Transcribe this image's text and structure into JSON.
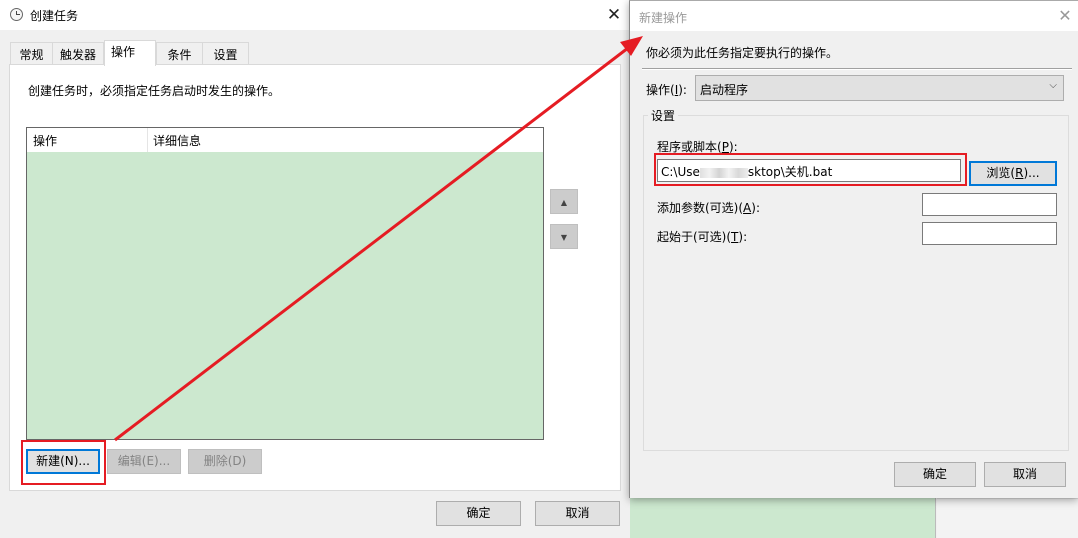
{
  "create_task_dialog": {
    "title": "创建任务",
    "close_glyph": "✕",
    "tabs": [
      {
        "label": "常规",
        "active": false
      },
      {
        "label": "触发器",
        "active": false
      },
      {
        "label": "操作",
        "active": true
      },
      {
        "label": "条件",
        "active": false
      },
      {
        "label": "设置",
        "active": false
      }
    ],
    "description": "创建任务时，必须指定任务启动时发生的操作。",
    "actions_table": {
      "columns": [
        "操作",
        "详细信息"
      ],
      "rows": []
    },
    "move_up_glyph": "▲",
    "move_down_glyph": "▼",
    "buttons": {
      "new": "新建(N)...",
      "edit": "编辑(E)...",
      "delete": "删除(D)",
      "ok": "确定",
      "cancel": "取消"
    }
  },
  "new_action_dialog": {
    "title": "新建操作",
    "close_glyph": "✕",
    "instruction": "你必须为此任务指定要执行的操作。",
    "action_label": "操作(I):",
    "action_value": "启动程序",
    "chevron_glyph": "⌵",
    "settings_group_title": "设置",
    "program_label": "程序或脚本(P):",
    "program_value_prefix": "C:\\Use",
    "program_value_suffix": "sktop\\关机.bat",
    "browse_button": "浏览(R)...",
    "arguments_label": "添加参数(可选)(A):",
    "arguments_value": "",
    "start_in_label": "起始于(可选)(T):",
    "start_in_value": "",
    "buttons": {
      "ok": "确定",
      "cancel": "取消"
    }
  },
  "annotation_colors": {
    "highlight": "#e51c23",
    "focus": "#0078d7",
    "list_background": "#cce8cf"
  }
}
